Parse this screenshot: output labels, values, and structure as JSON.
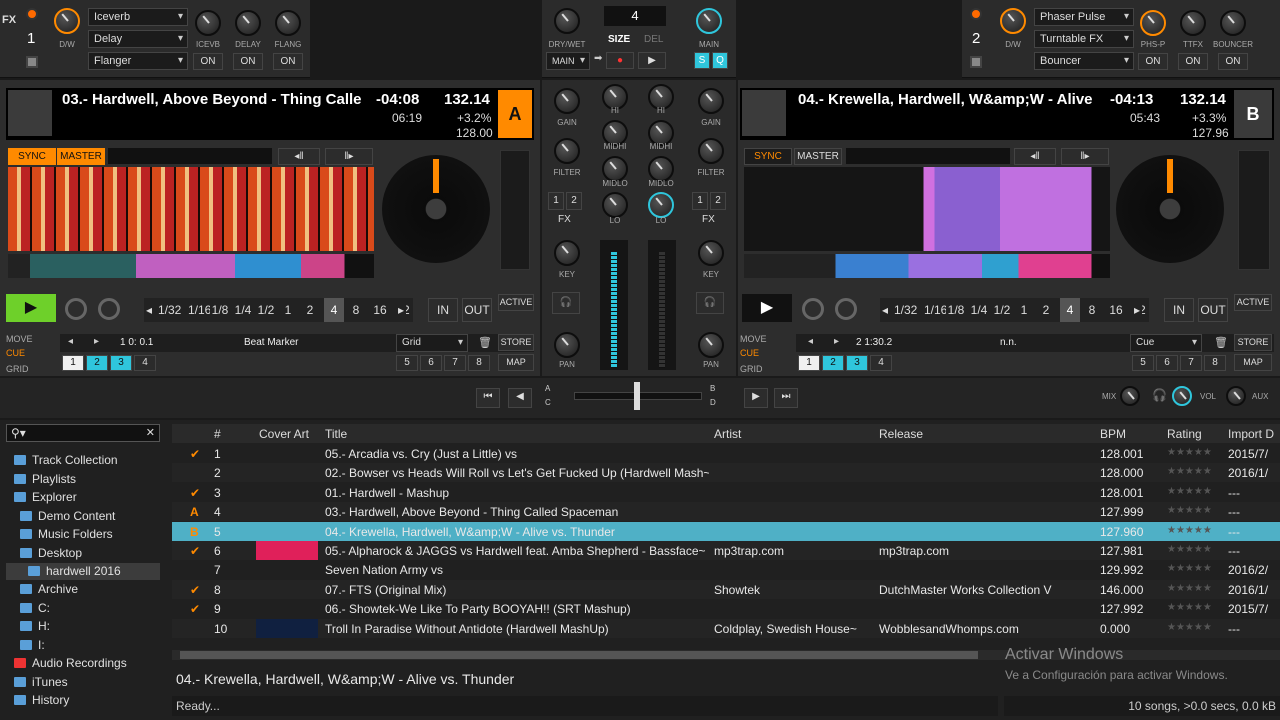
{
  "fx_left": {
    "label": "FX",
    "unit": "1",
    "dw": "D/W",
    "slot1": "Iceverb",
    "slot2": "Delay",
    "slot3": "Flanger",
    "knob_labels": [
      "ICEVB",
      "DELAY",
      "FLANG"
    ],
    "on": "ON"
  },
  "fx_right": {
    "label": "FX",
    "unit": "2",
    "dw": "D/W",
    "slot1": "Phaser Pulse",
    "slot2": "Turntable FX",
    "slot3": "Bouncer",
    "knob_labels": [
      "PHS-P",
      "TTFX",
      "BOUNCER"
    ],
    "on": "ON"
  },
  "master": {
    "drywet": "DRY/WET",
    "size_value": "4",
    "size": "SIZE",
    "del": "DEL",
    "main": "MAIN",
    "main_label": "MAIN",
    "s": "S",
    "q": "Q"
  },
  "deckA": {
    "title": "03.- Hardwell, Above Beyond - Thing Calle",
    "remaining": "-04:08",
    "elapsed": "06:19",
    "bpm": "132.14",
    "pitch": "+3.2%",
    "base_bpm": "128.00",
    "letter": "A",
    "sync": "SYNC",
    "master": "MASTER",
    "loops": [
      "1/32",
      "1/16",
      "1/8",
      "1/4",
      "1/2",
      "1",
      "2",
      "4",
      "8",
      "16",
      "32"
    ],
    "in": "IN",
    "out": "OUT",
    "active": "ACTIVE",
    "move": "MOVE",
    "cue": "CUE",
    "grid": "GRID",
    "pos": "1  0: 0.1",
    "marker": "Beat Marker",
    "mode": "Grid",
    "store": "STORE",
    "map": "MAP",
    "hotcues_top": [
      "1",
      "2",
      "3",
      "4"
    ],
    "hotcues_bottom": [
      "5",
      "6",
      "7",
      "8"
    ]
  },
  "deckB": {
    "title": "04.- Krewella, Hardwell, W&amp;W - Alive",
    "remaining": "-04:13",
    "elapsed": "05:43",
    "bpm": "132.14",
    "pitch": "+3.3%",
    "base_bpm": "127.96",
    "letter": "B",
    "sync": "SYNC",
    "master": "MASTER",
    "loops": [
      "1/32",
      "1/16",
      "1/8",
      "1/4",
      "1/2",
      "1",
      "2",
      "4",
      "8",
      "16",
      "32"
    ],
    "in": "IN",
    "out": "OUT",
    "active": "ACTIVE",
    "move": "MOVE",
    "cue": "CUE",
    "grid": "GRID",
    "pos": "2  1:30.2",
    "marker": "n.n.",
    "mode": "Cue",
    "store": "STORE",
    "map": "MAP",
    "hotcues_top": [
      "1",
      "2",
      "3",
      "4"
    ],
    "hotcues_bottom": [
      "5",
      "6",
      "7",
      "8"
    ]
  },
  "mixer": {
    "gain": "GAIN",
    "hi": "HI",
    "midhi": "MIDHI",
    "midlo": "MIDLO",
    "lo": "LO",
    "filter": "FILTER",
    "fx1": "1",
    "fx2": "2",
    "fx": "FX",
    "key": "KEY",
    "pan": "PAN",
    "xA": "A",
    "xB": "B",
    "xC": "C",
    "xD": "D"
  },
  "header_right": {
    "mix": "MIX",
    "vol": "VOL",
    "aux": "AUX"
  },
  "tree": [
    "Track Collection",
    "Playlists",
    "Explorer",
    "Demo Content",
    "Music Folders",
    "Desktop",
    "hardwell 2016",
    "Archive",
    "C:",
    "H:",
    "I:",
    "Audio Recordings",
    "iTunes",
    "History"
  ],
  "columns": [
    "#",
    "Cover Art",
    "Title",
    "Artist",
    "Release",
    "BPM",
    "Rating",
    "Import D"
  ],
  "rows": [
    {
      "n": "1",
      "title": "05.- Arcadia vs. Cry (Just a Little) vs",
      "artist": "",
      "release": "",
      "bpm": "128.001",
      "imp": "2015/7/"
    },
    {
      "n": "2",
      "title": "02.- Bowser vs Heads Will Roll vs Let's Get Fucked Up (Hardwell Mash~",
      "artist": "",
      "release": "",
      "bpm": "128.000",
      "imp": "2016/1/"
    },
    {
      "n": "3",
      "title": "01.- Hardwell - Mashup",
      "artist": "",
      "release": "",
      "bpm": "128.001",
      "imp": "---"
    },
    {
      "n": "4",
      "title": "03.- Hardwell, Above Beyond - Thing Called Spaceman",
      "artist": "",
      "release": "",
      "bpm": "127.999",
      "imp": "---"
    },
    {
      "n": "5",
      "title": "04.- Krewella, Hardwell, W&amp;W - Alive vs. Thunder",
      "artist": "",
      "release": "",
      "bpm": "127.960",
      "imp": "---"
    },
    {
      "n": "6",
      "title": "05.- Alpharock & JAGGS vs Hardwell feat. Amba Shepherd  - Bassface~",
      "artist": "mp3trap.com",
      "release": "mp3trap.com",
      "bpm": "127.981",
      "imp": "---"
    },
    {
      "n": "7",
      "title": "Seven Nation Army vs",
      "artist": "",
      "release": "",
      "bpm": "129.992",
      "imp": "2016/2/"
    },
    {
      "n": "8",
      "title": "07.- FTS (Original Mix)",
      "artist": "Showtek",
      "release": "DutchMaster Works Collection V",
      "bpm": "146.000",
      "imp": "2016/1/"
    },
    {
      "n": "9",
      "title": "06.- Showtek-We Like To Party BOOYAH!! (SRT Mashup)",
      "artist": "",
      "release": "",
      "bpm": "127.992",
      "imp": "2015/7/"
    },
    {
      "n": "10",
      "title": "Troll In Paradise Without Antidote (Hardwell MashUp)",
      "artist": "Coldplay, Swedish House~",
      "release": "WobblesandWhomps.com",
      "bpm": "0.000",
      "imp": "---"
    }
  ],
  "preview_title": "04.- Krewella, Hardwell, W&amp;W - Alive vs. Thunder",
  "status_left": "Ready...",
  "status_right": "10 songs, >0.0 secs, 0.0 kB",
  "watermark1": "Activar Windows",
  "watermark2": "Ve a Configuración para activar Windows.",
  "colors": {
    "accent": "#ff8a00",
    "teal": "#2fc6dc",
    "selected_row": "#4fb0c6"
  }
}
